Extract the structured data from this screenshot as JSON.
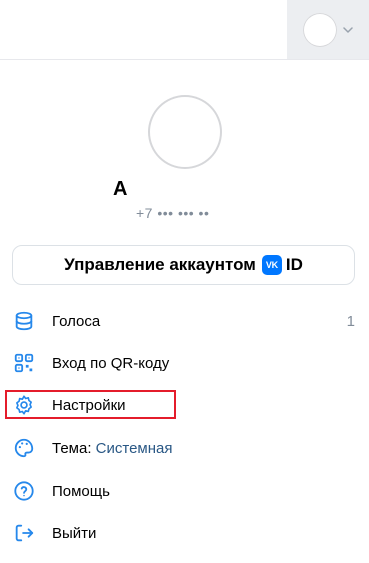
{
  "user": {
    "name": "А",
    "phone": "+7 ••• ••• ••"
  },
  "manage_button": {
    "label": "Управление аккаунтом",
    "badge": "VK",
    "id_label": "ID"
  },
  "menu": [
    {
      "label": "Голоса",
      "count": "1",
      "icon": "coins-stack-icon"
    },
    {
      "label": "Вход по QR-коду",
      "icon": "qr-code-icon"
    },
    {
      "label": "Настройки",
      "icon": "gear-icon"
    },
    {
      "label": "Тема:",
      "value": "Системная",
      "icon": "palette-icon"
    },
    {
      "label": "Помощь",
      "icon": "help-icon"
    },
    {
      "label": "Выйти",
      "icon": "logout-icon"
    }
  ],
  "colors": {
    "accent": "#2688eb",
    "link": "#2a5885",
    "highlight": "#e41c2b",
    "vk_blue": "#0077ff"
  }
}
